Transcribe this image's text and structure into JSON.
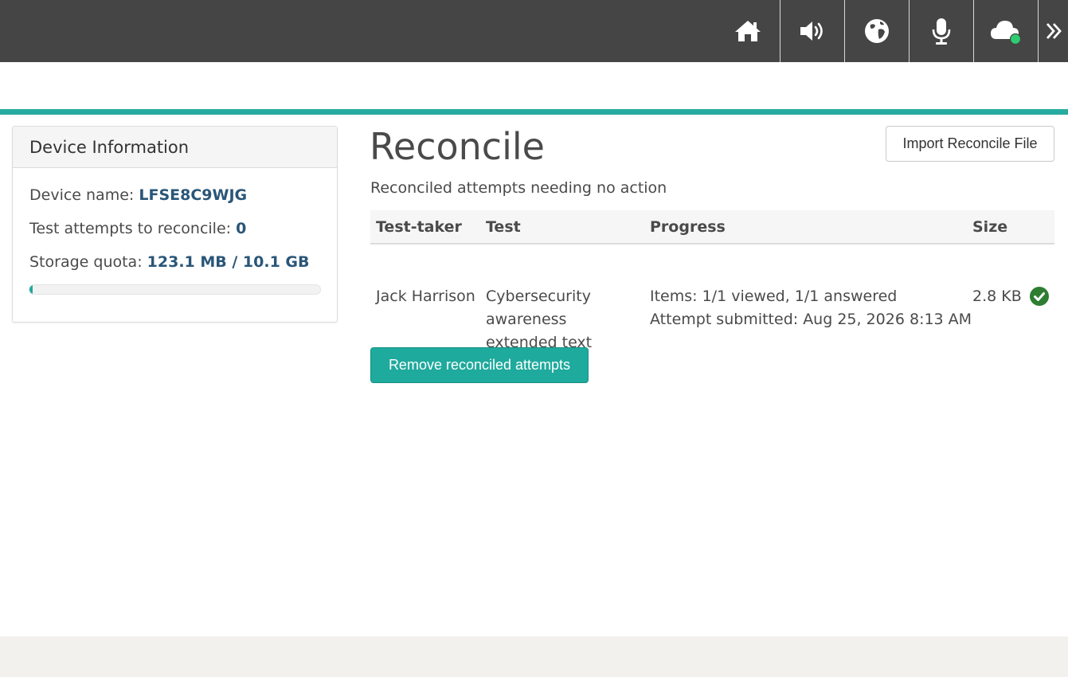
{
  "topbar": {
    "buttons": [
      {
        "icon": "home-icon"
      },
      {
        "icon": "speaker-icon"
      },
      {
        "icon": "globe-icon"
      },
      {
        "icon": "microphone-icon"
      },
      {
        "icon": "cloud-icon",
        "status_color": "#2ecc71"
      },
      {
        "icon": "chevron-double-right-icon"
      }
    ]
  },
  "device_panel": {
    "title": "Device Information",
    "device_name_label": "Device name:",
    "device_name_value": "LFSE8C9WJG",
    "attempts_label": "Test attempts to reconcile:",
    "attempts_value": "0",
    "storage_label": "Storage quota:",
    "storage_value": "123.1 MB / 10.1 GB",
    "storage_fraction": 0.012
  },
  "main": {
    "title": "Reconcile",
    "import_button": "Import Reconcile File",
    "subtitle": "Reconciled attempts needing no action",
    "table": {
      "headers": [
        "Test-taker",
        "Test",
        "Progress",
        "Size"
      ],
      "rows": [
        {
          "test_taker": "Jack Harrison",
          "test_lines": [
            "Cybersecurity",
            "awareness",
            "extended text"
          ],
          "progress_items": "Items: 1/1 viewed, 1/1 answered",
          "progress_submitted": "Attempt submitted: Aug 25, 2026 8:13 AM",
          "size": "2.8 KB",
          "status_icon": "check-circle-icon"
        }
      ]
    },
    "remove_button": "Remove reconciled attempts"
  },
  "colors": {
    "topbar": "#454545",
    "accent": "#1eaa9c",
    "value_text": "#2a5678",
    "success": "#2e7d32"
  }
}
